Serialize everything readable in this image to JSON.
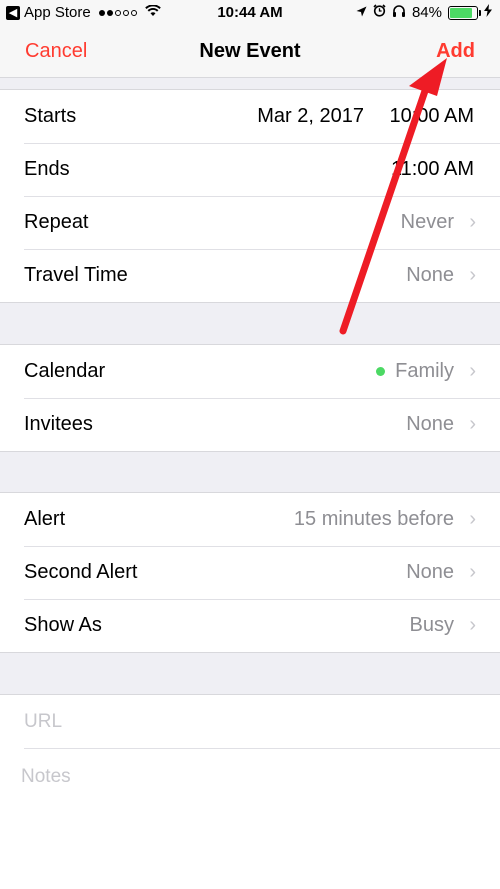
{
  "status_bar": {
    "carrier": "App Store",
    "time": "10:44 AM",
    "battery": "84%",
    "battery_level": 0.84,
    "icons": [
      "back-app-icon",
      "signal-icon",
      "wifi-icon",
      "location-icon",
      "alarm-icon",
      "headphones-icon",
      "battery-icon",
      "charging-icon"
    ]
  },
  "nav": {
    "cancel": "Cancel",
    "title": "New Event",
    "add": "Add"
  },
  "time_section": {
    "starts_label": "Starts",
    "starts_date": "Mar 2, 2017",
    "starts_time": "10:00 AM",
    "ends_label": "Ends",
    "ends_time": "11:00 AM",
    "repeat_label": "Repeat",
    "repeat_value": "Never",
    "travel_label": "Travel Time",
    "travel_value": "None"
  },
  "calendar_section": {
    "calendar_label": "Calendar",
    "calendar_value": "Family",
    "calendar_color": "#4cd964",
    "invitees_label": "Invitees",
    "invitees_value": "None"
  },
  "alert_section": {
    "alert_label": "Alert",
    "alert_value": "15 minutes before",
    "second_alert_label": "Second Alert",
    "second_alert_value": "None",
    "show_as_label": "Show As",
    "show_as_value": "Busy"
  },
  "extra_section": {
    "url_placeholder": "URL",
    "notes_placeholder": "Notes"
  },
  "annotation": {
    "arrow_color": "#ee1c25",
    "arrow_target": "Add"
  },
  "colors": {
    "accent": "#ff3b30",
    "secondary_text": "#8e8e93",
    "chevron": "#c7c7cc",
    "background": "#efeff4"
  }
}
